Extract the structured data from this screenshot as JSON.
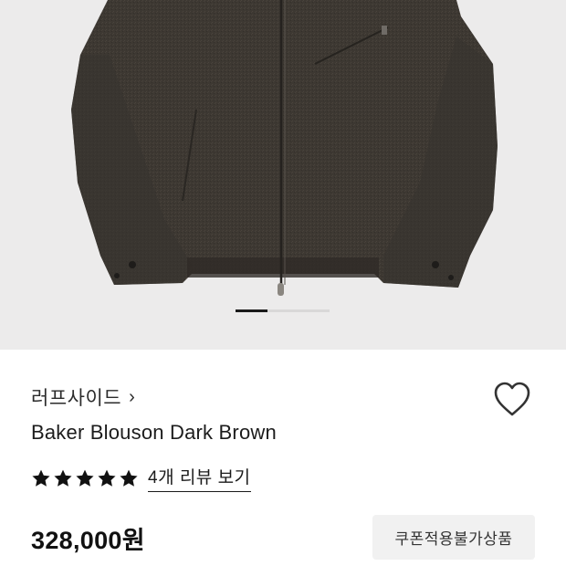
{
  "gallery": {
    "image_alt": "Baker Blouson Dark Brown jacket",
    "slide_index": 1,
    "total_slides": 3
  },
  "product": {
    "brand": "러프사이드",
    "brand_chevron": "›",
    "title": "Baker Blouson Dark Brown",
    "rating": 5,
    "review_link": "4개 리뷰 보기",
    "price": "328,000원",
    "coupon_button": "쿠폰적용불가상품"
  },
  "colors": {
    "hero_bg": "#ecebeb",
    "jacket": "#3f3a34",
    "star": "#111111",
    "coupon_bg": "#f1f1f1"
  },
  "icons": {
    "wishlist": "heart-outline-icon",
    "star": "star-filled-icon",
    "chevron": "chevron-right-icon"
  }
}
